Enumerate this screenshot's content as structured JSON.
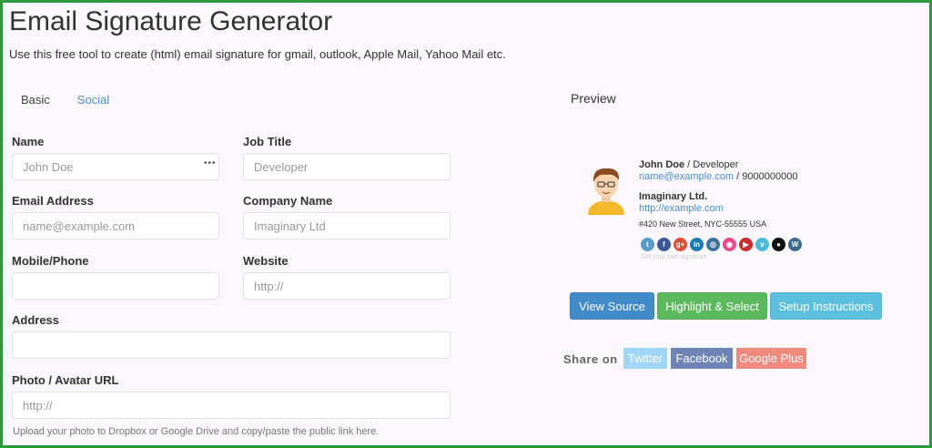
{
  "header": {
    "title": "Email Signature Generator",
    "subtitle": "Use this free tool to create (html) email signature for gmail, outlook, Apple Mail, Yahoo Mail etc."
  },
  "tabs": [
    {
      "label": "Basic",
      "active": true
    },
    {
      "label": "Social",
      "active": false
    }
  ],
  "form": {
    "name": {
      "label": "Name",
      "placeholder": "John Doe",
      "value": ""
    },
    "job_title": {
      "label": "Job Title",
      "placeholder": "Developer",
      "value": ""
    },
    "email": {
      "label": "Email Address",
      "placeholder": "name@example.com",
      "value": ""
    },
    "company": {
      "label": "Company Name",
      "placeholder": "Imaginary Ltd",
      "value": ""
    },
    "phone": {
      "label": "Mobile/Phone",
      "placeholder": "",
      "value": ""
    },
    "website": {
      "label": "Website",
      "placeholder": "http://",
      "value": ""
    },
    "address": {
      "label": "Address",
      "placeholder": "",
      "value": ""
    },
    "photo": {
      "label": "Photo / Avatar URL",
      "placeholder": "http://",
      "value": "",
      "hint": "Upload your photo to Dropbox or Google Drive and copy/paste the public link here."
    }
  },
  "preview": {
    "title": "Preview",
    "signature": {
      "name": "John Doe",
      "sep": " / ",
      "job": "Developer",
      "email": "name@example.com",
      "phone_sep": " / ",
      "phone": "9000000000",
      "company": "Imaginary Ltd.",
      "website": "http://example.com",
      "address": "#420 New Street, NYC-55555 USA",
      "credit": "Get your own signature"
    },
    "social_icons": [
      {
        "name": "twitter-icon",
        "color": "#5b9bc8",
        "glyph": "t"
      },
      {
        "name": "facebook-icon",
        "color": "#3b5998",
        "glyph": "f"
      },
      {
        "name": "google-plus-icon",
        "color": "#dd4b39",
        "glyph": "g+"
      },
      {
        "name": "linkedin-icon",
        "color": "#1a7bb0",
        "glyph": "in"
      },
      {
        "name": "instagram-icon",
        "color": "#3f729b",
        "glyph": "◎"
      },
      {
        "name": "dribbble-icon",
        "color": "#e8488a",
        "glyph": "◉"
      },
      {
        "name": "youtube-icon",
        "color": "#cc2b2b",
        "glyph": "▶"
      },
      {
        "name": "vimeo-icon",
        "color": "#4bbbd8",
        "glyph": "v"
      },
      {
        "name": "github-icon",
        "color": "#111111",
        "glyph": "●"
      },
      {
        "name": "wordpress-icon",
        "color": "#3a6b8c",
        "glyph": "W"
      }
    ]
  },
  "actions": {
    "view_source": "View Source",
    "highlight": "Highlight & Select",
    "setup": "Setup Instructions"
  },
  "share": {
    "label": "Share on",
    "twitter": "Twitter",
    "facebook": "Facebook",
    "google_plus": "Google Plus"
  },
  "colors": {
    "primary": "#428bca",
    "success": "#5cb85c",
    "info": "#5bc0de",
    "twitter": "#9fd5f5",
    "facebook": "#6d84b4",
    "google_plus": "#f08a7e",
    "border": "#2a9a3a"
  }
}
